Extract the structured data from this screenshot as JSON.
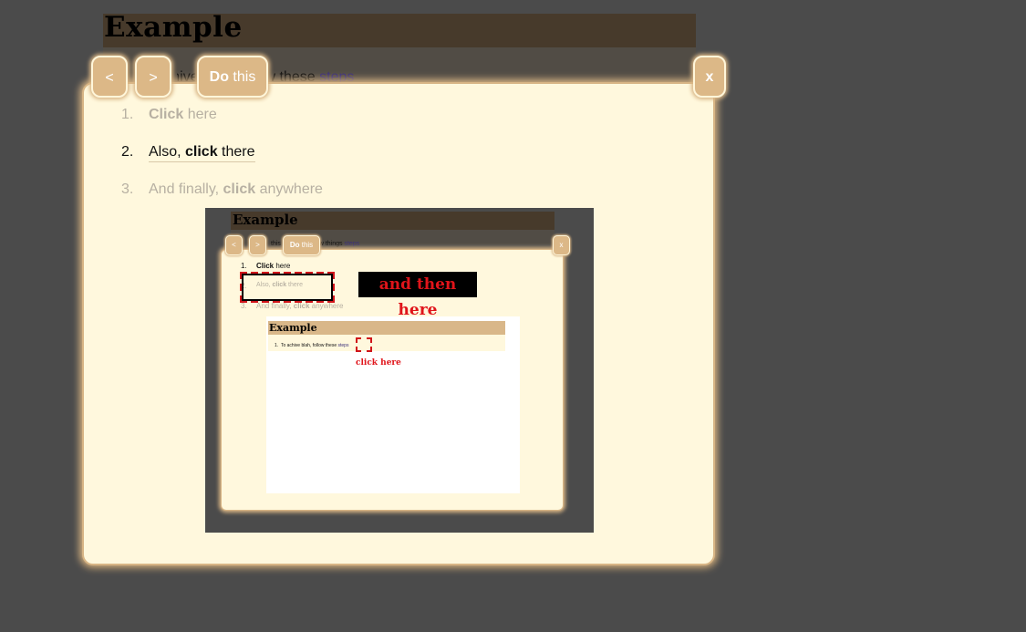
{
  "page": {
    "title": "Example",
    "intro_prefix": "To achive blah, follow these ",
    "intro_link": "steps",
    "visible_fragment_a": "hiv",
    "visible_fragment_b": "w these "
  },
  "toolbar": {
    "prev_label": "<",
    "next_label": ">",
    "do_bold": "Do",
    "do_rest": " this",
    "close_label": "x"
  },
  "steps": [
    {
      "num": "1.",
      "pre": "",
      "bold": "Click",
      "post": " here"
    },
    {
      "num": "2.",
      "pre": "Also, ",
      "bold": "click",
      "post": " there"
    },
    {
      "num": "3.",
      "pre": "And finally, ",
      "bold": "click",
      "post": " anywhere"
    }
  ],
  "preview": {
    "title": "Example",
    "line_fragment_a": "this",
    "line_fragment_b": "w things ",
    "line_link": "steps",
    "callout": "and then here",
    "inner": {
      "title": "Example",
      "line_num": "1.",
      "line_text": "To achive blah, follow these ",
      "line_link": "steps",
      "callout": "click here"
    }
  },
  "colors": {
    "overlay": "#4b4b4b",
    "panel_bg": "#fff8dd",
    "accent": "#dcb887",
    "callout_red": "#e0141a"
  }
}
